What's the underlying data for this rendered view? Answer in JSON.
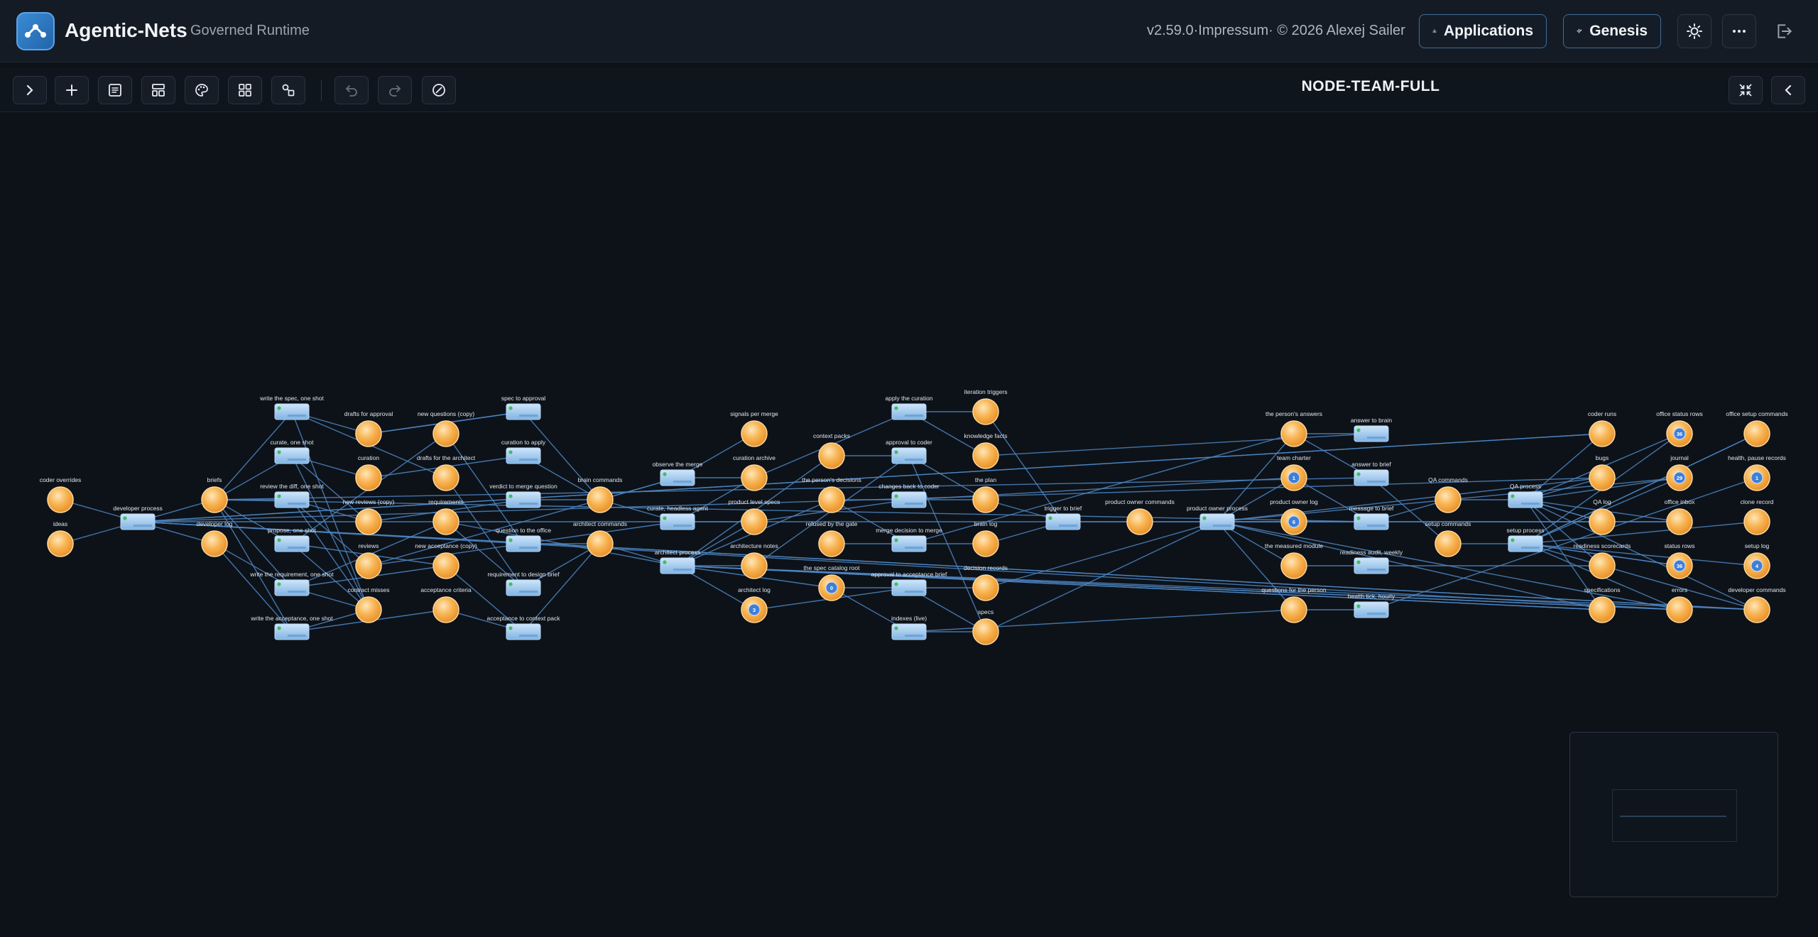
{
  "app": {
    "title": "Agentic-Nets",
    "subtitle": "Governed Runtime",
    "version": "v2.59.0·Impressum· © 2026 Alexej Sailer"
  },
  "header": {
    "applications_label": "Applications",
    "genesis_label": "Genesis",
    "icons": [
      "apps-icon",
      "sparkle-icon",
      "sun-icon",
      "more-icon",
      "logout-icon"
    ]
  },
  "toolbar": {
    "net_title": "NODE-TEAM-FULL",
    "icons": [
      "chevron-right-icon",
      "plus-icon",
      "list-icon",
      "layout-icon",
      "palette-icon",
      "grid-icon",
      "shapes-icon",
      "undo-icon",
      "redo-icon",
      "ban-icon",
      "collapse-icon",
      "chevron-left-icon"
    ]
  },
  "colors": {
    "place": "#f7b24f",
    "transition": "#8fc0ea",
    "edge": "#4d86c2",
    "token": "#3f7fd6"
  },
  "places": [
    {
      "id": "p1",
      "label": "coder overrides"
    },
    {
      "id": "p2",
      "label": "ideas"
    },
    {
      "id": "p3",
      "label": "briefs"
    },
    {
      "id": "p4",
      "label": "developer log"
    },
    {
      "id": "p5",
      "label": "drafts for approval"
    },
    {
      "id": "p6",
      "label": "curation"
    },
    {
      "id": "p7",
      "label": "new reviews (copy)"
    },
    {
      "id": "p8",
      "label": "reviews"
    },
    {
      "id": "p9",
      "label": "contract misses"
    },
    {
      "id": "p10",
      "label": "new questions (copy)"
    },
    {
      "id": "p11",
      "label": "drafts for the architect"
    },
    {
      "id": "p12",
      "label": "requirements"
    },
    {
      "id": "p13",
      "label": "new acceptance (copy)"
    },
    {
      "id": "p14",
      "label": "acceptance criteria"
    },
    {
      "id": "p15",
      "label": "brain commands"
    },
    {
      "id": "p16",
      "label": "architect commands"
    },
    {
      "id": "p17",
      "label": "signals per merge"
    },
    {
      "id": "p18",
      "label": "curation archive"
    },
    {
      "id": "p19",
      "label": "product level specs"
    },
    {
      "id": "p20",
      "label": "architecture notes"
    },
    {
      "id": "p21",
      "label": "architect log",
      "tokens": "3"
    },
    {
      "id": "p22",
      "label": "context packs"
    },
    {
      "id": "p23",
      "label": "the person's decisions"
    },
    {
      "id": "p24",
      "label": "refused by the gate"
    },
    {
      "id": "p25",
      "label": "the spec catalog root",
      "tokens": "0"
    },
    {
      "id": "p26",
      "label": "iteration triggers"
    },
    {
      "id": "p27",
      "label": "knowledge facts"
    },
    {
      "id": "p28",
      "label": "the plan"
    },
    {
      "id": "p29",
      "label": "brain log"
    },
    {
      "id": "p30",
      "label": "decision records"
    },
    {
      "id": "p31",
      "label": "specs"
    },
    {
      "id": "p32",
      "label": "product owner commands"
    },
    {
      "id": "p33",
      "label": "the person's answers"
    },
    {
      "id": "p34",
      "label": "team charter",
      "tokens": "1"
    },
    {
      "id": "p35",
      "label": "product owner log",
      "tokens": "6"
    },
    {
      "id": "p36",
      "label": "the measured module"
    },
    {
      "id": "p37",
      "label": "questions for the person"
    },
    {
      "id": "p38",
      "label": "QA commands"
    },
    {
      "id": "p39",
      "label": "setup commands"
    },
    {
      "id": "p40",
      "label": "coder runs"
    },
    {
      "id": "p41",
      "label": "bugs"
    },
    {
      "id": "p42",
      "label": "QA log"
    },
    {
      "id": "p43",
      "label": "readiness scorecards"
    },
    {
      "id": "p44",
      "label": "specifications"
    },
    {
      "id": "p45",
      "label": "office status rows",
      "tokens": "36"
    },
    {
      "id": "p46",
      "label": "journal",
      "tokens": "29"
    },
    {
      "id": "p47",
      "label": "office inbox"
    },
    {
      "id": "p48",
      "label": "status rows",
      "tokens": "36"
    },
    {
      "id": "p49",
      "label": "errors"
    },
    {
      "id": "p50",
      "label": "office setup commands"
    },
    {
      "id": "p51",
      "label": "health, pause records",
      "tokens": "1"
    },
    {
      "id": "p52",
      "label": "clone record"
    },
    {
      "id": "p53",
      "label": "setup log",
      "tokens": "4"
    },
    {
      "id": "p54",
      "label": "developer commands"
    }
  ],
  "transitions": [
    {
      "id": "t1",
      "label": "developer process"
    },
    {
      "id": "t2",
      "label": "write the spec, one shot"
    },
    {
      "id": "t3",
      "label": "curate, one shot"
    },
    {
      "id": "t4",
      "label": "review the diff, one shot"
    },
    {
      "id": "t5",
      "label": "propose, one shot"
    },
    {
      "id": "t6",
      "label": "write the requirement, one shot"
    },
    {
      "id": "t7",
      "label": "write the acceptance, one shot"
    },
    {
      "id": "t8",
      "label": "spec to approval"
    },
    {
      "id": "t9",
      "label": "curation to apply"
    },
    {
      "id": "t10",
      "label": "verdict to merge question"
    },
    {
      "id": "t11",
      "label": "question to the office"
    },
    {
      "id": "t12",
      "label": "requirement to design brief"
    },
    {
      "id": "t13",
      "label": "acceptance to context pack"
    },
    {
      "id": "t14",
      "label": "observe the merge"
    },
    {
      "id": "t15",
      "label": "curate, headless agent"
    },
    {
      "id": "t16",
      "label": "architect process"
    },
    {
      "id": "t17",
      "label": "apply the curation"
    },
    {
      "id": "t18",
      "label": "approval to coder"
    },
    {
      "id": "t19",
      "label": "changes back to coder"
    },
    {
      "id": "t20",
      "label": "merge decision to merge"
    },
    {
      "id": "t21",
      "label": "approval to acceptance brief"
    },
    {
      "id": "t22",
      "label": "indexes (live)"
    },
    {
      "id": "t23",
      "label": "trigger to brief"
    },
    {
      "id": "t24",
      "label": "product owner process"
    },
    {
      "id": "t25",
      "label": "answer to brain"
    },
    {
      "id": "t26",
      "label": "answer to brief"
    },
    {
      "id": "t27",
      "label": "message to brief"
    },
    {
      "id": "t28",
      "label": "readiness audit, weekly"
    },
    {
      "id": "t29",
      "label": "health tick, hourly"
    },
    {
      "id": "t30",
      "label": "QA process"
    },
    {
      "id": "t31",
      "label": "setup process"
    }
  ]
}
